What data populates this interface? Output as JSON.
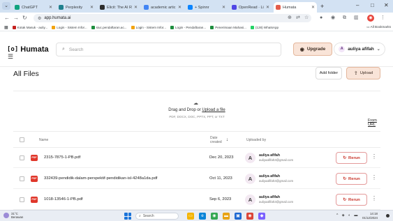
{
  "browser": {
    "tabs": [
      {
        "label": "ChatGPT",
        "color": "#10a37f",
        "active": false
      },
      {
        "label": "Perplexity",
        "color": "#20808d",
        "active": false
      },
      {
        "label": "Elicit: The AI Re...",
        "color": "#2d2d2d",
        "active": false
      },
      {
        "label": "academic artic...",
        "color": "#4285f4",
        "active": false
      },
      {
        "label": "+ Spinnr",
        "color": "#0b84ff",
        "active": false
      },
      {
        "label": "OpenRead · Lin...",
        "color": "#4f46e5",
        "active": false
      },
      {
        "label": "Humata",
        "color": "#e35d4b",
        "active": true
      }
    ],
    "new_tab": "+",
    "window_controls": [
      "–",
      "□",
      "✕"
    ],
    "url": "app.humata.ai",
    "bookmarks": [
      {
        "label": "Kotak Masuk - auliy...",
        "color": "#c5221f"
      },
      {
        "label": "Login - Sistem Infor...",
        "color": "#f2a30f"
      },
      {
        "label": "siuc.pendaftaran.ac...",
        "color": "#1e8e3e"
      },
      {
        "label": "Login - Sistem Infor...",
        "color": "#f2a30f"
      },
      {
        "label": "Login - Pendaftaran...",
        "color": "#1e8e3e"
      },
      {
        "label": "Penerimaan Mahasi...",
        "color": "#1e8e3e"
      },
      {
        "label": "(128) WhatsApp",
        "color": "#25d366"
      }
    ],
    "all_bookmarks": "All Bookmarks"
  },
  "app": {
    "logo": "Humata",
    "logo_mark": "[o]",
    "search_placeholder": "Search",
    "upgrade_label": "Upgrade",
    "user_initial": "A",
    "user_name": "auliya afifah",
    "page_title": "All Files",
    "add_folder_label": "Add folder",
    "upload_label": "Upload",
    "dropzone": {
      "text_prefix": "Drag and Drop or ",
      "link": "Upload a file",
      "types": "PDF, DOCX, DOC, PPTX, PPT, or TXT",
      "from_url": "From URL"
    },
    "columns": {
      "name": "Name",
      "date_line1": "Date",
      "date_line2": "created",
      "uploaded_by": "Uploaded by"
    },
    "files": [
      {
        "name": "2315-7875-1-PB.pdf",
        "date": "Dec 20, 2023",
        "initial": "A",
        "user": "auliya afifah",
        "email": "auliyaafifah3@gmail.com",
        "action": "Rerun",
        "badge": "PDF"
      },
      {
        "name": "332439-pendidik-dalam-perspektif-pendidikan-isl-4248a1da.pdf",
        "date": "Oct 11, 2023",
        "initial": "A",
        "user": "auliya afifah",
        "email": "auliyaafifah3@gmail.com",
        "action": "Rerun",
        "badge": "PDF"
      },
      {
        "name": "1018-13546-1-PB.pdf",
        "date": "Sep 6, 2023",
        "initial": "A",
        "user": "auliya afifah",
        "email": "auliyaafifah3@gmail.com",
        "action": "Rerun",
        "badge": "PDF"
      }
    ]
  },
  "taskbar": {
    "weather_temp": "31°C",
    "weather_desc": "Berawan",
    "search_placeholder": "Search",
    "apps": [
      {
        "name": "file-explorer",
        "color": "#f4b400",
        "glyph": "▭"
      },
      {
        "name": "edge",
        "color": "#0b84d8",
        "glyph": "e"
      },
      {
        "name": "chrome",
        "color": "#34a853",
        "glyph": "◉"
      },
      {
        "name": "folder",
        "color": "#e8a317",
        "glyph": "▬"
      },
      {
        "name": "store",
        "color": "#1c67d1",
        "glyph": "▣"
      },
      {
        "name": "chrome-2",
        "color": "#db4437",
        "glyph": "◉"
      },
      {
        "name": "photos",
        "color": "#7b61ff",
        "glyph": "◆"
      }
    ],
    "tray": "^ ◈ ◐ ▬",
    "time": "14:18",
    "date": "01/12/2024"
  }
}
